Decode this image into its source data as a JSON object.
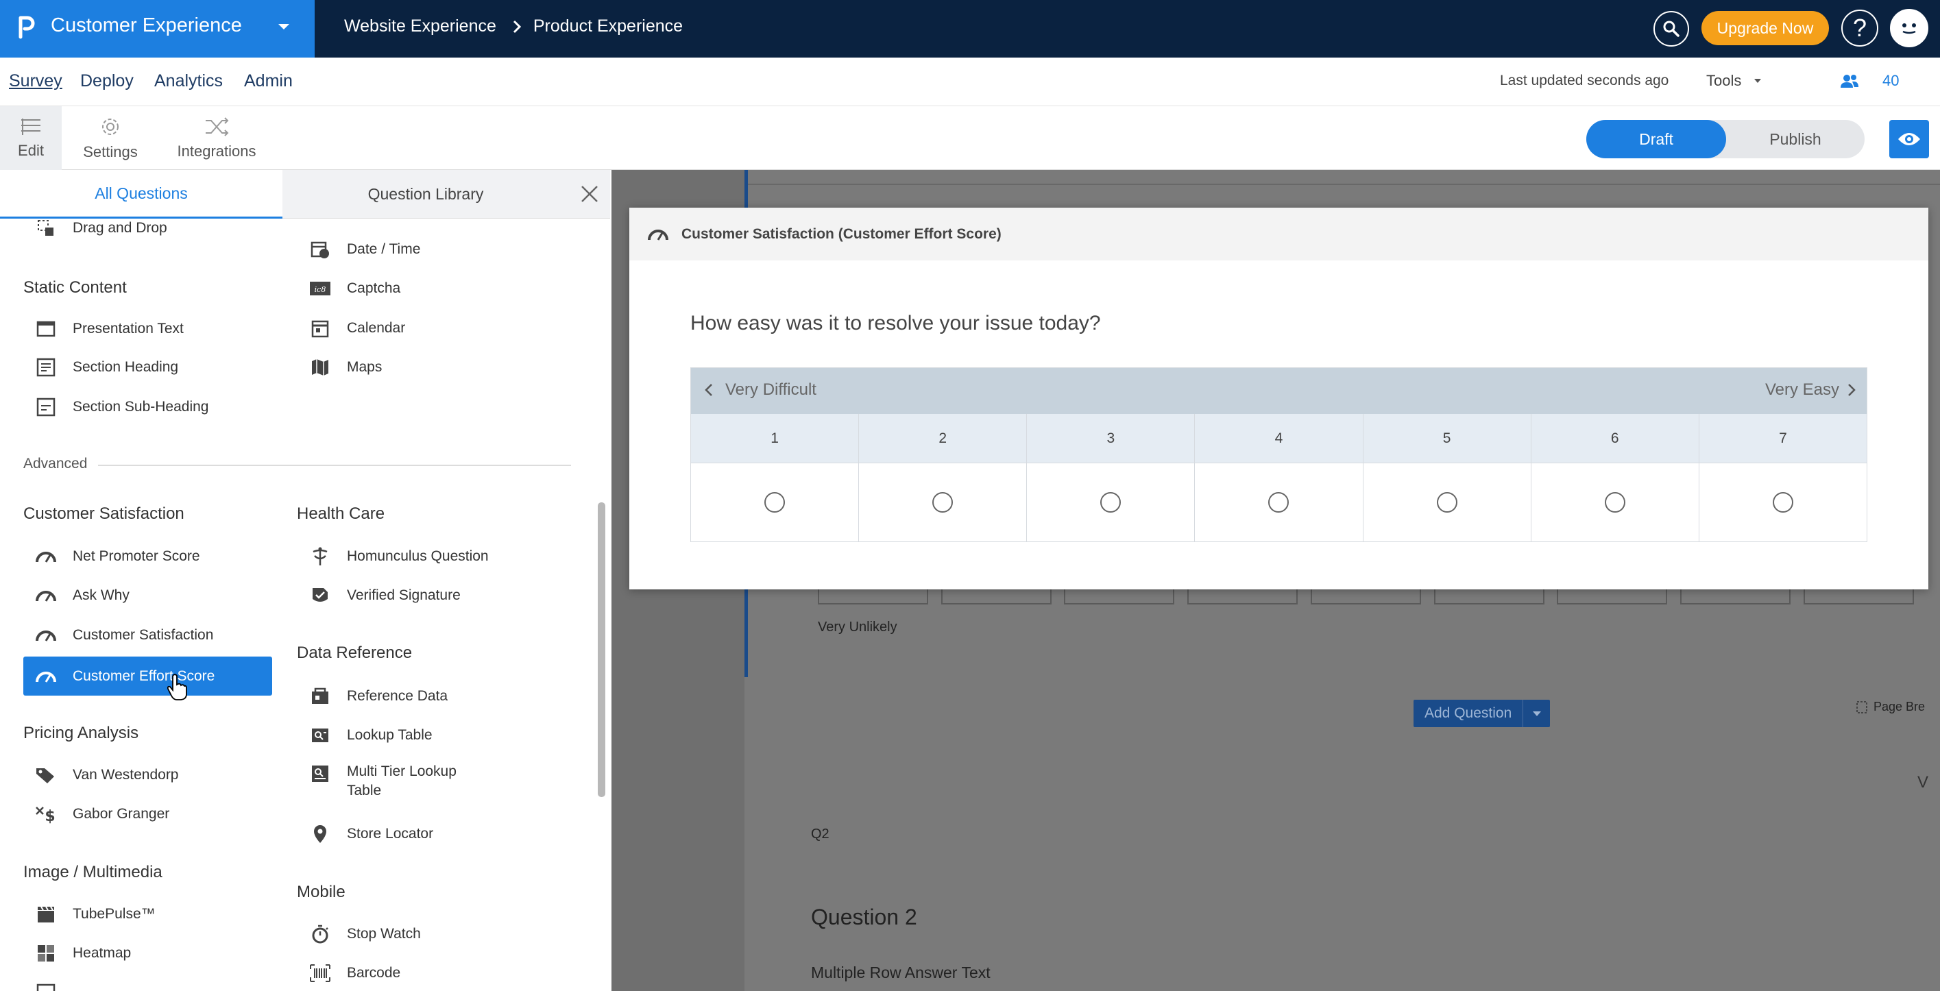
{
  "header": {
    "app_title": "Customer Experience",
    "breadcrumb": [
      "Website Experience",
      "Product Experience"
    ],
    "upgrade_label": "Upgrade Now",
    "help_label": "?"
  },
  "nav": {
    "items": [
      "Survey",
      "Deploy",
      "Analytics",
      "Admin"
    ],
    "last_updated": "Last updated seconds ago",
    "tools_label": "Tools",
    "user_count": "40"
  },
  "toolbar": {
    "edit": "Edit",
    "settings": "Settings",
    "integrations": "Integrations",
    "draft": "Draft",
    "publish": "Publish"
  },
  "panel": {
    "tabs": [
      "All Questions",
      "Question Library"
    ],
    "advanced_label": "Advanced",
    "sections": {
      "static_content": "Static Content",
      "customer_satisfaction": "Customer Satisfaction",
      "pricing_analysis": "Pricing Analysis",
      "image_multimedia": "Image / Multimedia",
      "health_care": "Health Care",
      "data_reference": "Data Reference",
      "mobile": "Mobile"
    },
    "items": {
      "drag_drop": "Drag and Drop",
      "presentation_text": "Presentation Text",
      "section_heading": "Section Heading",
      "section_subheading": "Section Sub-Heading",
      "date_time": "Date / Time",
      "captcha": "Captcha",
      "calendar": "Calendar",
      "maps": "Maps",
      "nps": "Net Promoter Score",
      "ask_why": "Ask Why",
      "customer_satisfaction": "Customer Satisfaction",
      "customer_effort_score": "Customer Effort Score",
      "homunculus": "Homunculus Question",
      "verified_signature": "Verified Signature",
      "reference_data": "Reference Data",
      "lookup_table": "Lookup Table",
      "multi_tier_1": "Multi Tier Lookup",
      "multi_tier_2": "Table",
      "store_locator": "Store Locator",
      "van_westendorp": "Van Westendorp",
      "gabor_granger": "Gabor Granger",
      "tubepulse": "TubePulse™",
      "heatmap": "Heatmap",
      "stop_watch": "Stop Watch",
      "barcode": "Barcode"
    }
  },
  "preview": {
    "title": "Customer Satisfaction (Customer Effort Score)",
    "question": "How easy was it to resolve your issue today?",
    "left_anchor": "Very Difficult",
    "right_anchor": "Very Easy",
    "scale": [
      "1",
      "2",
      "3",
      "4",
      "5",
      "6",
      "7"
    ]
  },
  "background": {
    "very_unlikely": "Very Unlikely",
    "add_question": "Add Question",
    "page_break": "Page Bre",
    "q_num": "Q2",
    "q_title": "Question 2",
    "q_sub": "Multiple Row Answer Text",
    "edge_letter": "V"
  },
  "colors": {
    "brand_blue": "#1d7fe0",
    "topbar_navy": "#0a2240",
    "upgrade_orange": "#f5a01a"
  }
}
